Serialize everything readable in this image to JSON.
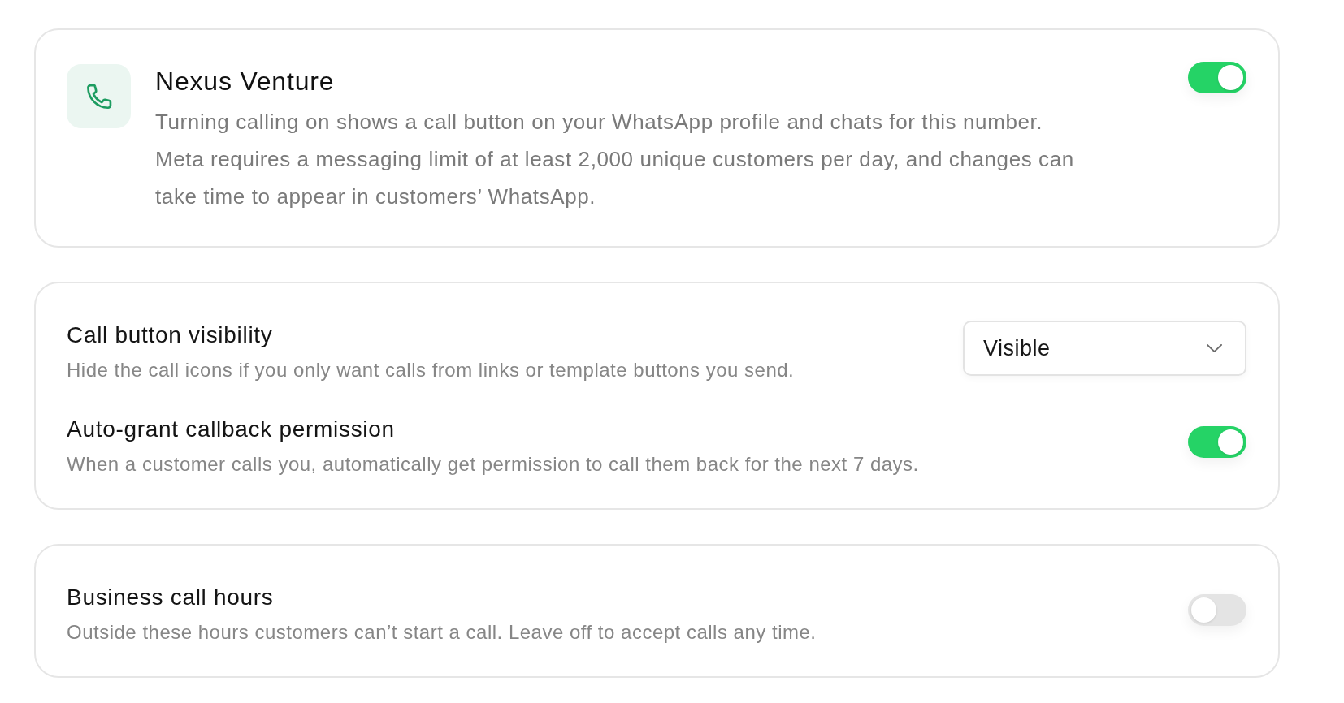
{
  "account": {
    "title": "Nexus Venture",
    "description": "Turning calling on shows a call button on your WhatsApp profile and chats for this number. Meta requires a messaging limit of at least 2,000 unique customers per day, and changes can take time to appear in customers’ WhatsApp.",
    "calling_on": true
  },
  "setting_groups": [
    {
      "rows": [
        {
          "kind": "select",
          "title": "Call button visibility",
          "description": "Hide the call icons if you only want calls from links or template buttons you send.",
          "value": "Visible"
        },
        {
          "kind": "toggle",
          "title": "Auto-grant callback permission",
          "description": "When a customer calls you, automatically get permission to call them back for the next 7 days.",
          "on": true
        }
      ]
    },
    {
      "rows": [
        {
          "kind": "toggle",
          "title": "Business call hours",
          "description": "Outside these hours customers can’t start a call. Leave off to accept calls any time.",
          "on": false
        }
      ]
    }
  ]
}
